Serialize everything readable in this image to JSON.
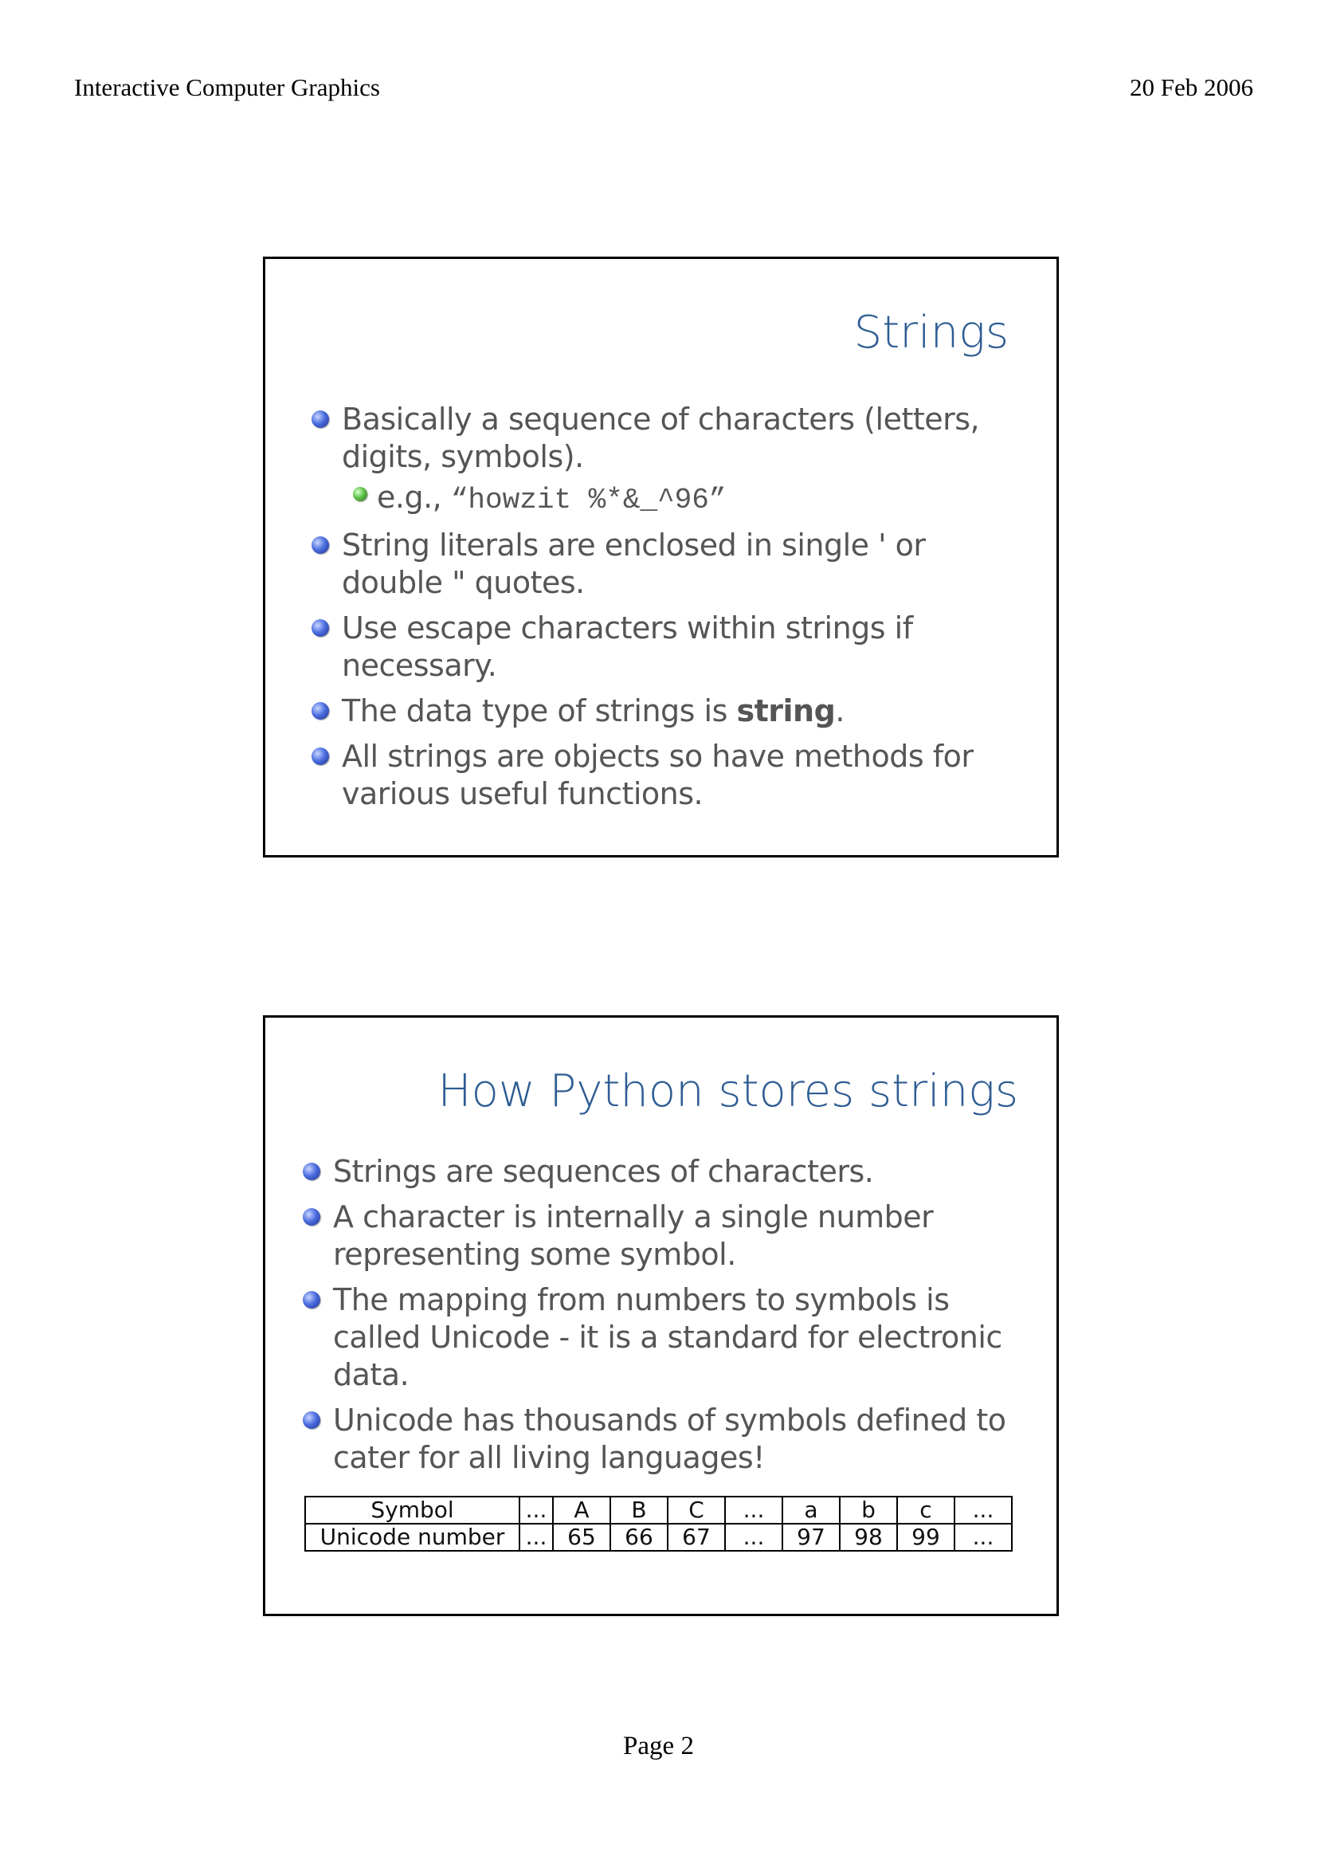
{
  "header": {
    "course": "Interactive Computer Graphics",
    "date": "20 Feb 2006"
  },
  "slide1": {
    "title": "Strings",
    "bullets": [
      {
        "text": "Basically a sequence of characters (letters, digits, symbols)."
      },
      {
        "prefix": "e.g., ",
        "code": "“howzit %*&_^96”"
      },
      {
        "text": "String literals are enclosed in single ' or double \" quotes."
      },
      {
        "text": "Use escape characters within strings if necessary."
      },
      {
        "prefix": "The data type of strings is ",
        "strong": "string",
        "suffix": "."
      },
      {
        "text": "All strings are objects so have methods for various useful functions."
      }
    ]
  },
  "slide2": {
    "title": "How Python stores strings",
    "bullets": [
      {
        "text": "Strings are sequences of characters."
      },
      {
        "text": "A character is internally a single number representing some symbol."
      },
      {
        "text": "The mapping from numbers to symbols is called Unicode - it is a standard for electronic data."
      },
      {
        "text": "Unicode has thousands of symbols defined to cater for all living languages!"
      }
    ],
    "table": {
      "row_labels": [
        "Symbol",
        "Unicode number"
      ],
      "symbols": [
        "...",
        "A",
        "B",
        "C",
        "...",
        "a",
        "b",
        "c",
        "..."
      ],
      "numbers": [
        "...",
        "65",
        "66",
        "67",
        "...",
        "97",
        "98",
        "99",
        "..."
      ]
    }
  },
  "footer": {
    "page": "Page 2"
  }
}
